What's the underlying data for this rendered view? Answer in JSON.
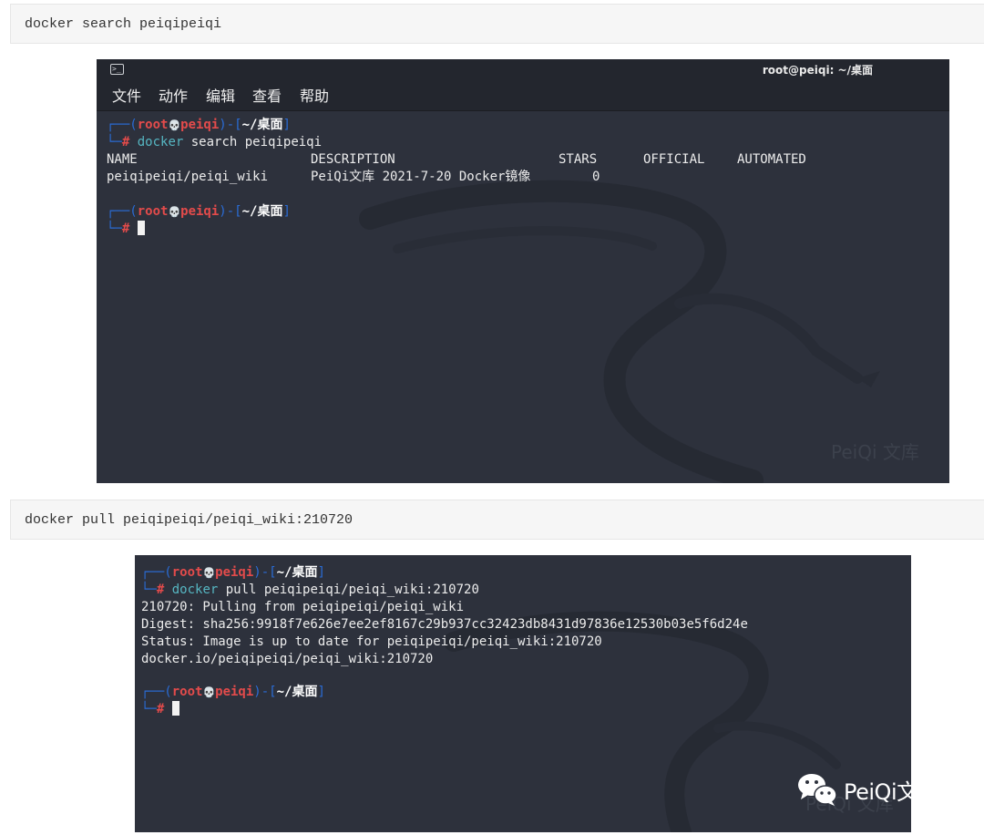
{
  "cmd1": "docker search peiqipeiqi",
  "cmd2": "docker pull peiqipeiqi/peiqi_wiki:210720",
  "terminal1": {
    "title": "root@peiqi: ~/桌面",
    "menu": [
      "文件",
      "动作",
      "编辑",
      "查看",
      "帮助"
    ],
    "prompt": {
      "user": "root",
      "skull": "💀",
      "host": "peiqi",
      "dir": "~/桌面"
    },
    "command": "docker search peiqipeiqi",
    "table_header": {
      "name": "NAME",
      "description": "DESCRIPTION",
      "stars": "STARS",
      "official": "OFFICIAL",
      "automated": "AUTOMATED"
    },
    "table_row": {
      "name": "peiqipeiqi/peiqi_wiki",
      "description": "PeiQi文库 2021-7-20 Docker镜像",
      "stars": "0"
    },
    "watermark": "PeiQi 文库"
  },
  "terminal2": {
    "prompt": {
      "user": "root",
      "skull": "💀",
      "host": "peiqi",
      "dir": "~/桌面"
    },
    "command": "docker pull peiqipeiqi/peiqi_wiki:210720",
    "output": [
      "210720: Pulling from peiqipeiqi/peiqi_wiki",
      "Digest: sha256:9918f7e626e7ee2ef8167c29b937cc32423db8431d97836e12530b03e5f6d24e",
      "Status: Image is up to date for peiqipeiqi/peiqi_wiki:210720",
      "docker.io/peiqipeiqi/peiqi_wiki:210720"
    ],
    "watermark": "PeiQi 文库"
  },
  "brand": "PeiQi文库",
  "colors": {
    "terminal_bg": "#2d313c",
    "prompt_frame": "#2a6cd6",
    "prompt_user": "#e34b4b",
    "command": "#56b6c2"
  }
}
